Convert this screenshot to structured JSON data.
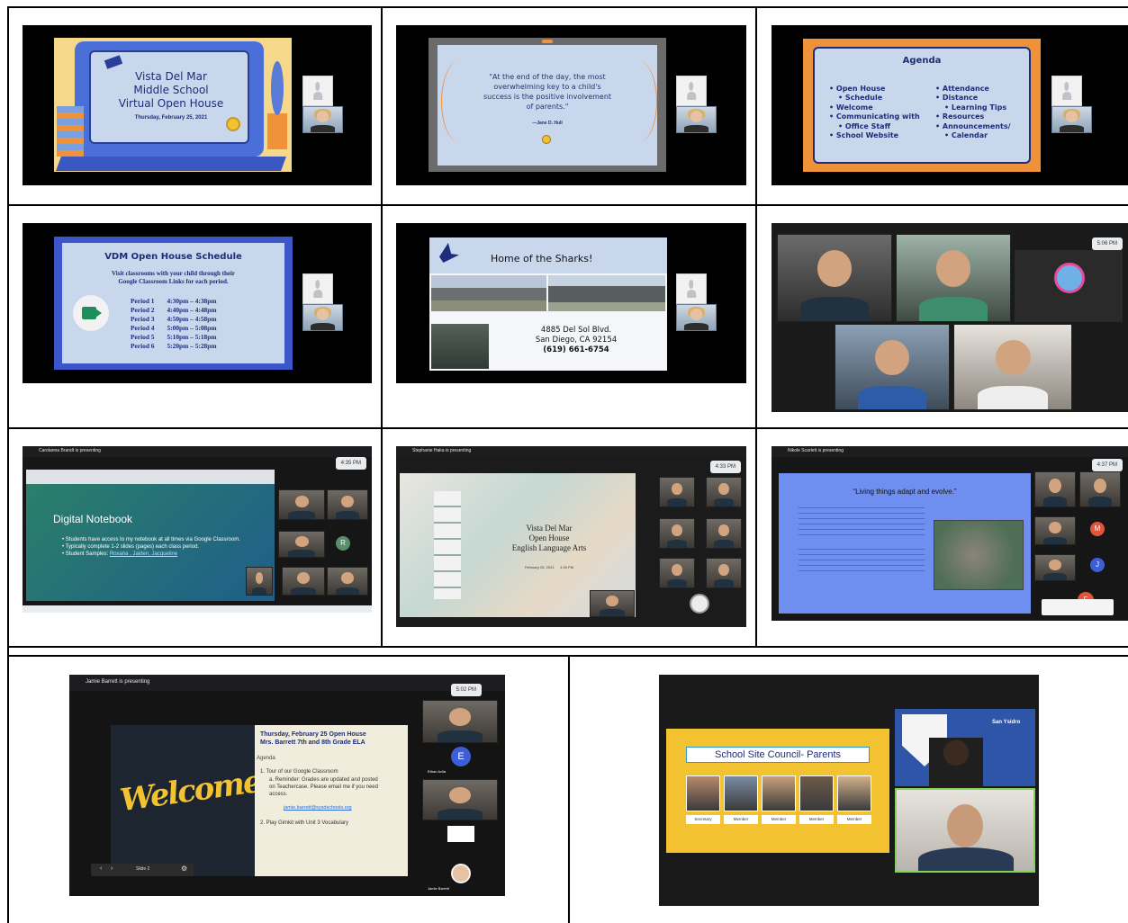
{
  "tiles": {
    "t1": {
      "title_lines": [
        "Vista Del Mar",
        "Middle School",
        "Virtual Open House"
      ],
      "date": "Thursday, February 25, 2021"
    },
    "t2": {
      "quote": "\"At the end of the day, the most overwhelming key to a child's success is the positive involvement of parents.\"",
      "author": "—Jane D. Hull"
    },
    "t3": {
      "title": "Agenda",
      "left_items": [
        "Open House",
        "Schedule",
        "Welcome",
        "Communicating with",
        "Office Staff",
        "School Website"
      ],
      "right_items": [
        "Attendance",
        "Distance",
        "Learning Tips",
        "Resources",
        "Announcements/",
        "Calendar"
      ]
    },
    "t4": {
      "title": "VDM Open House Schedule",
      "subtitle_lines": [
        "Visit classrooms with your child through their",
        "Google Classroom Links for each period."
      ],
      "periods": [
        {
          "label": "Period 1",
          "time": "4:30pm – 4:38pm"
        },
        {
          "label": "Period 2",
          "time": "4:40pm – 4:48pm"
        },
        {
          "label": "Period 3",
          "time": "4:50pm – 4:58pm"
        },
        {
          "label": "Period 4",
          "time": "5:00pm – 5:08pm"
        },
        {
          "label": "Period 5",
          "time": "5:10pm – 5:18pm"
        },
        {
          "label": "Period 6",
          "time": "5:20pm – 5:28pm"
        }
      ]
    },
    "t5": {
      "title": "Home of the Sharks!",
      "address_lines": [
        "4885 Del Sol Blvd.",
        "San Diego, CA 92154",
        "(619) 661-6754"
      ]
    },
    "t6": {
      "time": "5:06 PM"
    },
    "t7": {
      "presenter": "Carolanna Brandt is presenting",
      "time": "4:35 PM",
      "title": "Digital Notebook",
      "bullets": [
        "Students have access to my notebook at all times via Google Classroom.",
        "Typically complete 1-2 slides (pages) each class period."
      ],
      "samples_label": "Student Samples:",
      "samples_links": "Roxana , Jaiden, Jacqueline",
      "avatar_letter": "R"
    },
    "t8": {
      "presenter": "Stephanie Haka is presenting",
      "time": "4:33 PM",
      "slide_lines": [
        "Vista Del Mar",
        "Open House",
        "English Language Arts"
      ],
      "slide_date": "February 25, 2021      4:30 PM"
    },
    "t9": {
      "presenter": "Nikole Scarlett is presenting",
      "time": "4:37 PM",
      "title": "“Living things adapt and evolve.”",
      "avatar_letters": [
        "M",
        "J",
        "F"
      ]
    },
    "t10": {
      "presenter": "Jamie Barrett is presenting",
      "time": "5:02 PM",
      "welcome": "Welcome",
      "header_lines": [
        "Thursday, February 25 Open House",
        "Mrs. Barrett 7th and 8th Grade ELA"
      ],
      "agenda_label": "Agenda",
      "item1": "Tour of our Google Classroom",
      "item1a": "Reminder: Grades are updated and posted on Teachercase. Please email me if you need access.",
      "email": "jamie.barrett@sysdschools.org",
      "item2": "Play Gimkit with Unit 3 Vocabulary",
      "slide_label": "Slide 2",
      "avatar_letter": "E",
      "names": [
        "Ethan Avila",
        "Jamie Barrett"
      ]
    },
    "t11": {
      "title": "School Site Council- Parents",
      "roles": [
        "Secretary",
        "Member",
        "Member",
        "Member",
        "Member"
      ],
      "logo_text": "San Ysidro"
    }
  },
  "colors": {
    "grid_line": "#000000",
    "slide_blue": "#c9d7ec",
    "accent_orange": "#f0923a",
    "accent_royal": "#3c55c8",
    "accent_yellow": "#f2c230"
  }
}
